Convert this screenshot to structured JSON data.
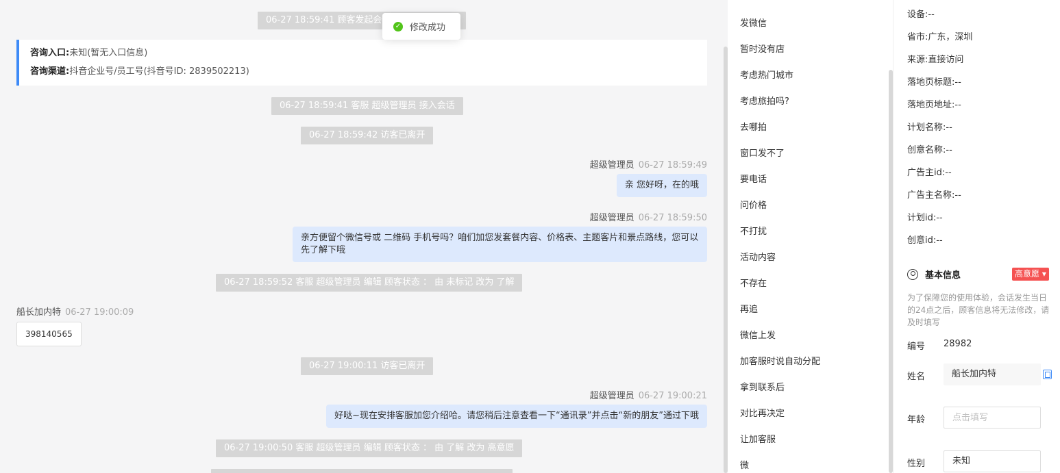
{
  "toast": {
    "text": "修改成功"
  },
  "chat": {
    "sys_top": "06-27 18:59:41 顾客发起会话",
    "entry": {
      "label1": "咨询入口:",
      "value1": "未知(暂无入口信息)",
      "label2": "咨询渠道:",
      "value2": "抖音企业号/员工号(抖音号ID: 2839502213)"
    },
    "sys1": "06-27 18:59:41 客服 超级管理员 接入会话",
    "sys2": "06-27 18:59:42 访客已离开",
    "msg1": {
      "name": "超级管理员",
      "time": "06-27 18:59:49",
      "text": "亲 您好呀，在的哦"
    },
    "msg2": {
      "name": "超级管理员",
      "time": "06-27 18:59:50",
      "text": "亲方便留个微信号或 二维码 手机号吗？咱们加您发套餐内容、价格表、主题客片和景点路线，您可以先了解下哦"
    },
    "sys3": "06-27 18:59:52 客服 超级管理员 编辑 顾客状态 ： 由 未标记 改为 了解",
    "msg3": {
      "name": "船长加内特",
      "time": "06-27 19:00:09",
      "text": "398140565"
    },
    "sys4": "06-27 19:00:11 访客已离开",
    "msg4": {
      "name": "超级管理员",
      "time": "06-27 19:00:21",
      "text": "好哒~现在安排客服加您介绍哈。请您稍后注意查看一下“通讯录”并点击“新的朋友”通过下哦"
    },
    "sys5": "06-27 19:00:50 客服 超级管理员 编辑 顾客状态 ： 由 了解 改为 高意愿"
  },
  "quick_replies": [
    "发微信",
    "暂时没有店",
    "考虑热门城市",
    "考虑旅拍吗?",
    "去哪拍",
    "窗口发不了",
    "要电话",
    "问价格",
    "不打扰",
    "活动内容",
    "不存在",
    "再追",
    "微信上发",
    "加客服时说自动分配",
    "拿到联系后",
    "对比再决定",
    "让加客服",
    "微"
  ],
  "visitor": {
    "rows": [
      {
        "k": "设备:",
        "v": "--"
      },
      {
        "k": "省市:",
        "v": "广东，深圳"
      },
      {
        "k": "来源:",
        "v": "直接访问"
      },
      {
        "k": "落地页标题:",
        "v": "--"
      },
      {
        "k": "落地页地址:",
        "v": "--"
      },
      {
        "k": "计划名称:",
        "v": "--"
      },
      {
        "k": "创意名称:",
        "v": "--"
      },
      {
        "k": "广告主id:",
        "v": "--"
      },
      {
        "k": "广告主名称:",
        "v": "--"
      },
      {
        "k": "计划id:",
        "v": "--"
      },
      {
        "k": "创意id:",
        "v": "--"
      }
    ],
    "basic_title": "基本信息",
    "intent_tag": "高意愿 ▾",
    "note": "为了保障您的使用体验，会话发生当日的24点之后，顾客信息将无法修改，请及时填写",
    "id_label": "编号",
    "id_value": "28982",
    "name_label": "姓名",
    "name_value": "船长加内特",
    "age_label": "年龄",
    "age_placeholder": "点击填写",
    "gender_label": "性别",
    "gender_value": "未知"
  },
  "colors": {
    "accent": "#3d8af7",
    "bubble": "#dde9fd",
    "tag": "#f55252",
    "success": "#52c41a"
  }
}
